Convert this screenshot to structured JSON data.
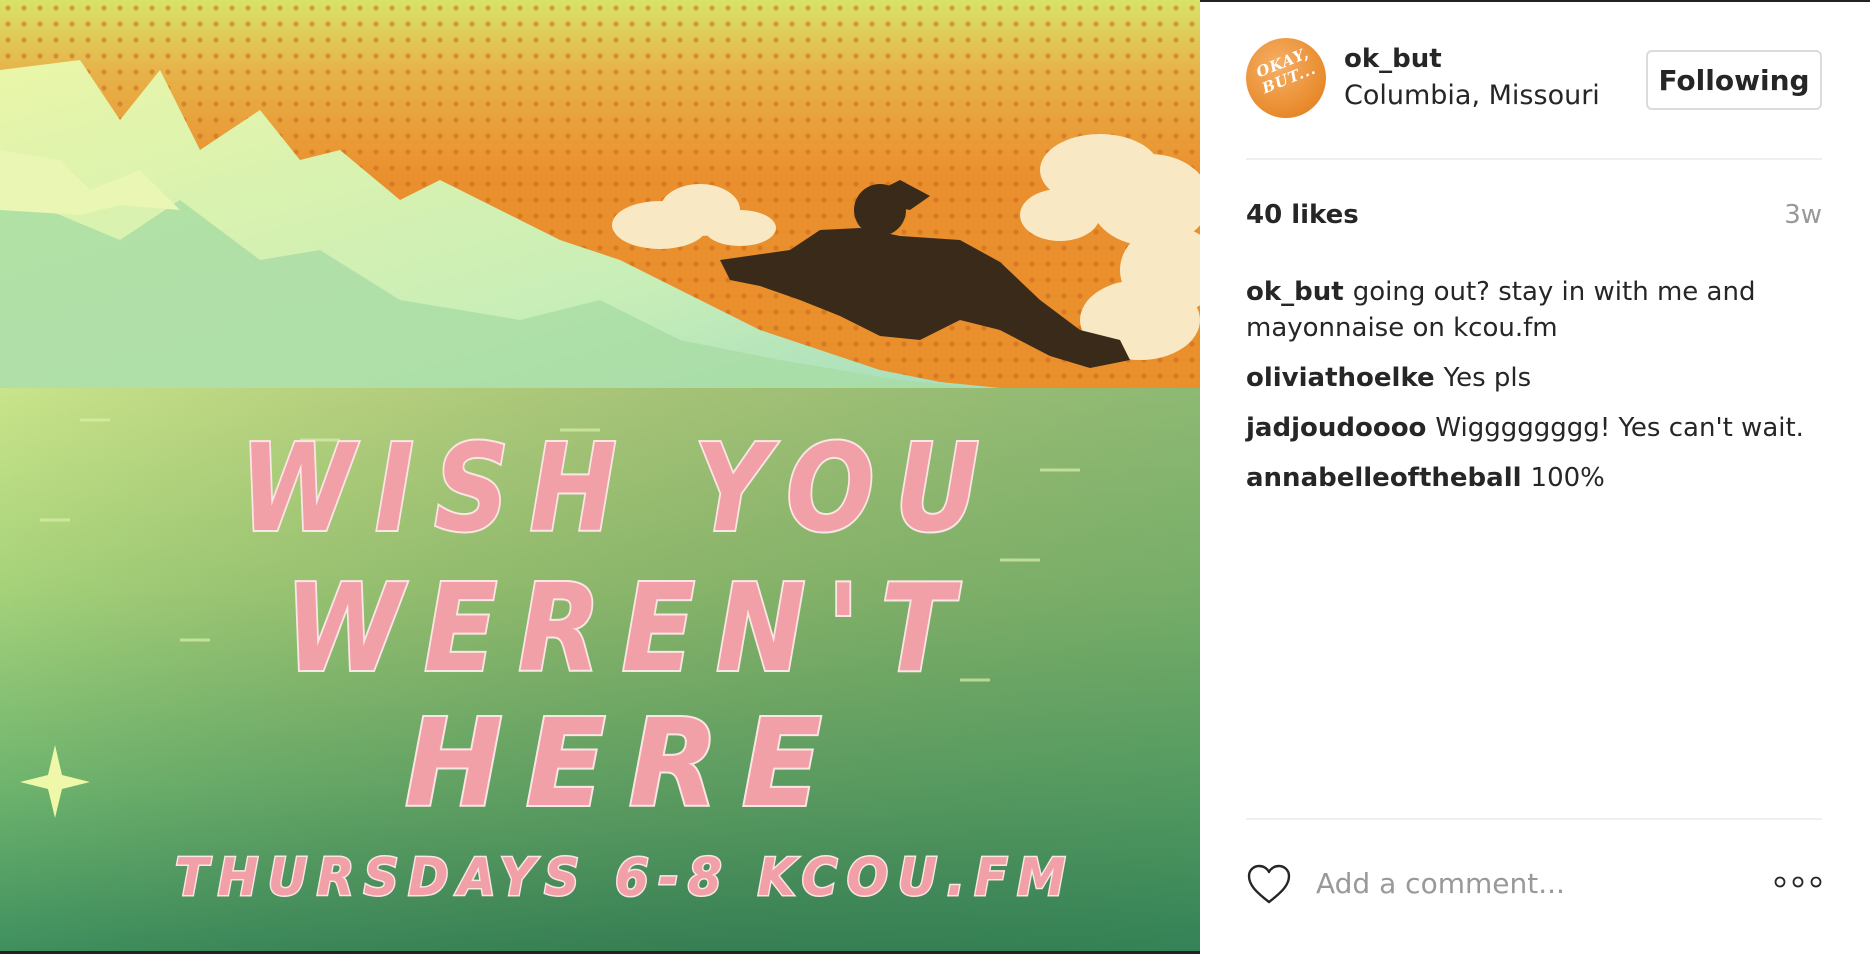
{
  "post": {
    "image": {
      "headline_line1": "WISH YOU",
      "headline_line2": "WEREN'T",
      "headline_line3": "HERE",
      "tagline": "THURSDAYS 6-8 KCOU.FM"
    }
  },
  "header": {
    "avatar_text_line1": "OKAY,",
    "avatar_text_line2": "BUT...",
    "username": "ok_but",
    "location": "Columbia, Missouri",
    "follow_label": "Following"
  },
  "stats": {
    "likes": "40 likes",
    "time": "3w"
  },
  "comments": [
    {
      "user": "ok_but",
      "text": "going out? stay in with me and mayonnaise on kcou.fm"
    },
    {
      "user": "oliviathoelke",
      "text": "Yes pls"
    },
    {
      "user": "jadjoudoooo",
      "text": "Wigggggggg! Yes can't wait."
    },
    {
      "user": "annabelleoftheball",
      "text": "100%"
    }
  ],
  "footer": {
    "comment_placeholder": "Add a comment...",
    "like_icon": "heart-icon",
    "more_icon": "more-options-icon"
  },
  "colors": {
    "sky_orange": "#e98f2c",
    "sky_yellow": "#e4e86a",
    "wave_mint": "#bfeab8",
    "sea_green": "#5aa267",
    "title_pink": "#f2a0a8"
  }
}
